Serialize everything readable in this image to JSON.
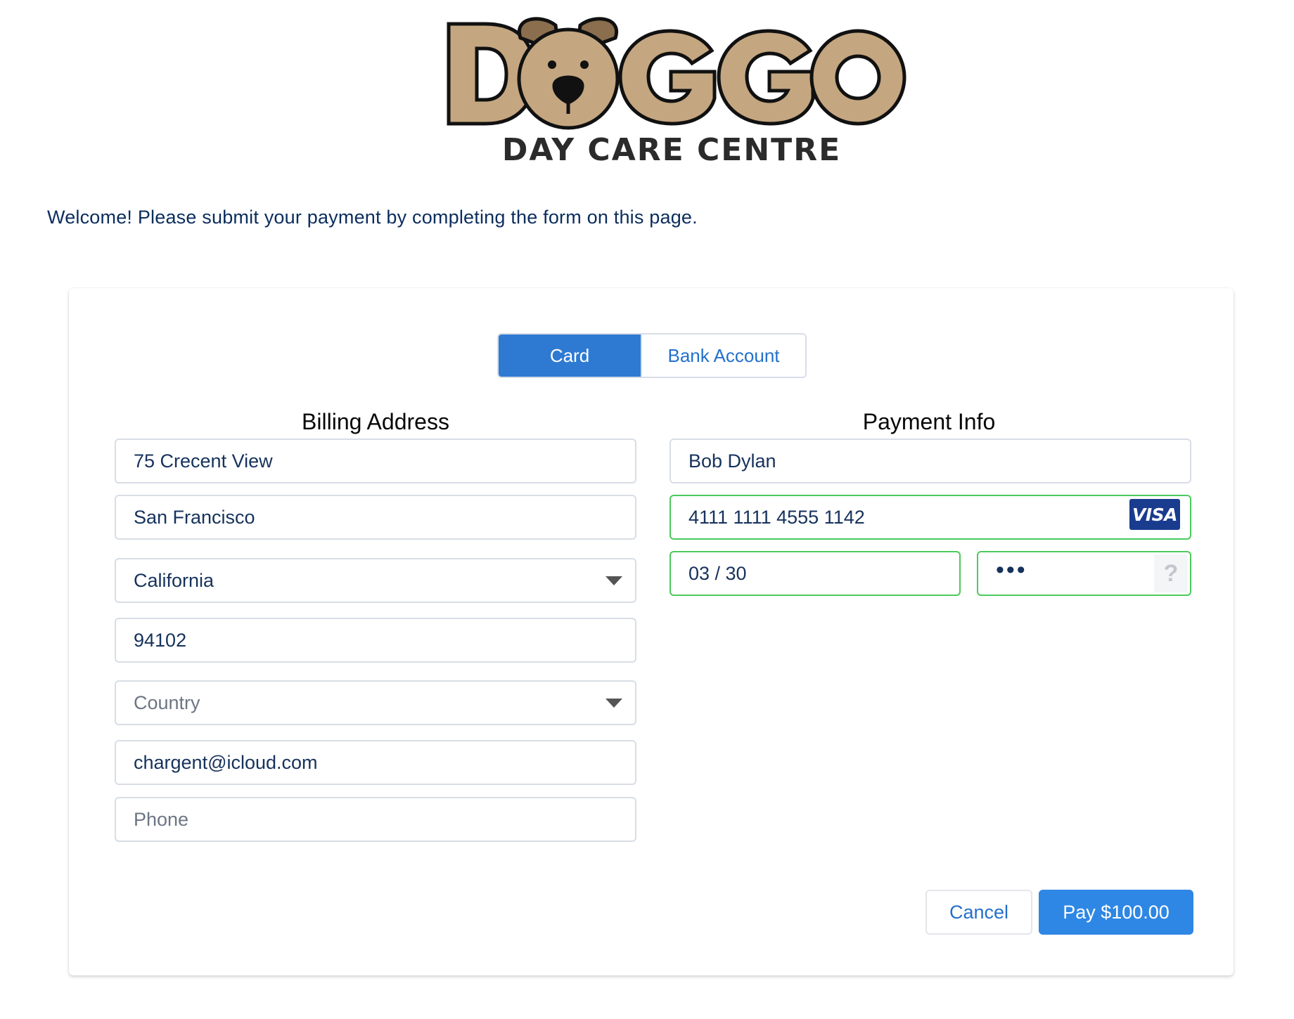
{
  "logo": {
    "word": "DOGGO",
    "tagline": "DAY CARE CENTRE"
  },
  "welcome_text": "Welcome! Please submit your payment by completing the form on this page.",
  "tabs": [
    {
      "label": "Card",
      "selected": true
    },
    {
      "label": "Bank Account",
      "selected": false
    }
  ],
  "billing": {
    "title": "Billing Address",
    "street": {
      "value": "75 Crecent View"
    },
    "city": {
      "value": "San Francisco"
    },
    "state": {
      "value": "California"
    },
    "zip": {
      "value": "94102"
    },
    "country": {
      "placeholder": "Country"
    },
    "email": {
      "value": "chargent@icloud.com"
    },
    "phone": {
      "placeholder": "Phone"
    }
  },
  "payment": {
    "title": "Payment Info",
    "name": {
      "value": "Bob Dylan"
    },
    "card_number": {
      "value": "4111 1111 4555 1142",
      "brand": "VISA"
    },
    "expiry": {
      "value": "03 / 30"
    },
    "cvc": {
      "value": "•••",
      "help": "?"
    }
  },
  "buttons": {
    "cancel": "Cancel",
    "pay": "Pay $100.00"
  },
  "colors": {
    "primary": "#2e7ad3",
    "pay_button": "#2e87e4",
    "link_text": "#2470cc",
    "valid_border": "#4bca5d",
    "text": "#16325c",
    "logo_fill": "#c4a680"
  },
  "icons": [
    "dog-face-icon",
    "visa-card-icon",
    "help-question-icon",
    "chevron-down-icon"
  ]
}
